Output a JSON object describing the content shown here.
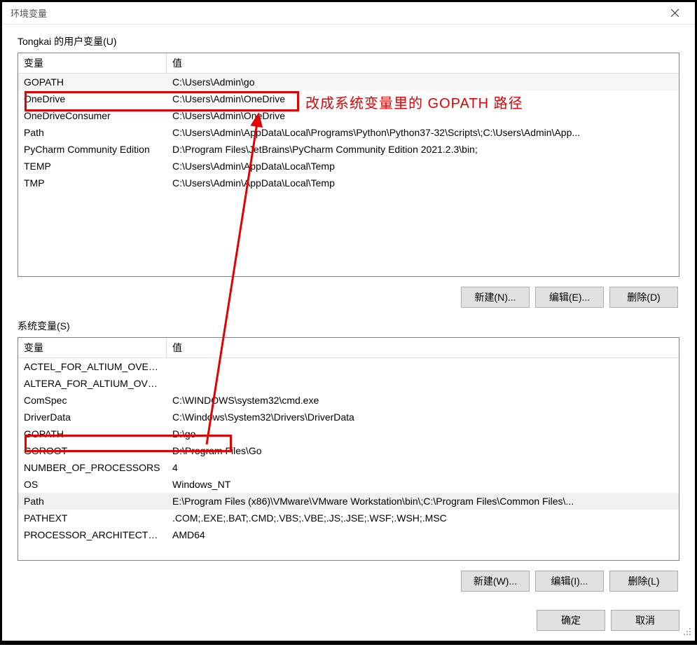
{
  "window": {
    "title": "环境变量"
  },
  "user_section": {
    "label": "Tongkai 的用户变量(U)",
    "header_var": "变量",
    "header_val": "值",
    "rows": [
      {
        "var": "GOPATH",
        "val": "C:\\Users\\Admin\\go",
        "sel": true
      },
      {
        "var": "OneDrive",
        "val": "C:\\Users\\Admin\\OneDrive"
      },
      {
        "var": "OneDriveConsumer",
        "val": "C:\\Users\\Admin\\OneDrive"
      },
      {
        "var": "Path",
        "val": "C:\\Users\\Admin\\AppData\\Local\\Programs\\Python\\Python37-32\\Scripts\\;C:\\Users\\Admin\\App..."
      },
      {
        "var": "PyCharm Community Edition",
        "val": "D:\\Program Files\\JetBrains\\PyCharm Community Edition 2021.2.3\\bin;"
      },
      {
        "var": "TEMP",
        "val": "C:\\Users\\Admin\\AppData\\Local\\Temp"
      },
      {
        "var": "TMP",
        "val": "C:\\Users\\Admin\\AppData\\Local\\Temp"
      }
    ],
    "btn_new": "新建(N)...",
    "btn_edit": "编辑(E)...",
    "btn_delete": "删除(D)"
  },
  "system_section": {
    "label": "系统变量(S)",
    "header_var": "变量",
    "header_val": "值",
    "rows": [
      {
        "var": "ACTEL_FOR_ALTIUM_OVER...",
        "val": ""
      },
      {
        "var": "ALTERA_FOR_ALTIUM_OVE...",
        "val": ""
      },
      {
        "var": "ComSpec",
        "val": "C:\\WINDOWS\\system32\\cmd.exe"
      },
      {
        "var": "DriverData",
        "val": "C:\\Windows\\System32\\Drivers\\DriverData"
      },
      {
        "var": "GOPATH",
        "val": "D:\\go"
      },
      {
        "var": "GOROOT",
        "val": "D:\\Program Files\\Go"
      },
      {
        "var": "NUMBER_OF_PROCESSORS",
        "val": "4"
      },
      {
        "var": "OS",
        "val": "Windows_NT"
      },
      {
        "var": "Path",
        "val": "E:\\Program Files (x86)\\VMware\\VMware Workstation\\bin\\;C:\\Program Files\\Common Files\\...",
        "sel2": true
      },
      {
        "var": "PATHEXT",
        "val": ".COM;.EXE;.BAT;.CMD;.VBS;.VBE;.JS;.JSE;.WSF;.WSH;.MSC"
      },
      {
        "var": "PROCESSOR_ARCHITECTURE",
        "val": "AMD64"
      }
    ],
    "btn_new": "新建(W)...",
    "btn_edit": "编辑(I)...",
    "btn_delete": "删除(L)"
  },
  "footer": {
    "ok": "确定",
    "cancel": "取消"
  },
  "annotation": {
    "text": "改成系统变量里的 GOPATH 路径",
    "color": "#e20000"
  }
}
